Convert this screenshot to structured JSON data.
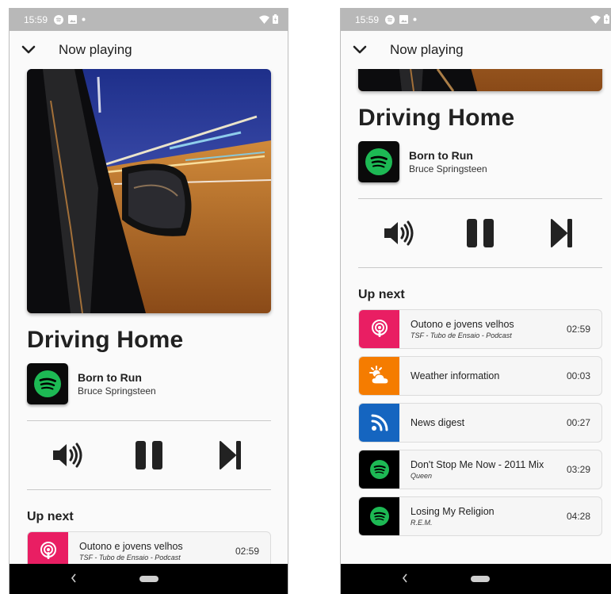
{
  "status": {
    "time": "15:59"
  },
  "app_bar": {
    "title": "Now playing"
  },
  "now_playing": {
    "title": "Driving Home",
    "source_title": "Born to Run",
    "source_subtitle": "Bruce Springsteen"
  },
  "up_next": {
    "heading": "Up next",
    "items": [
      {
        "title": "Outono e jovens velhos",
        "subtitle": "TSF - Tubo de Ensaio - Podcast",
        "duration": "02:59",
        "icon": "podcast-icon",
        "color": "#e91e63"
      },
      {
        "title": "Weather information",
        "subtitle": "",
        "duration": "00:03",
        "icon": "weather-icon",
        "color": "#f57c00"
      },
      {
        "title": "News digest",
        "subtitle": "",
        "duration": "00:27",
        "icon": "rss-icon",
        "color": "#1565c0"
      },
      {
        "title": "Don't Stop Me Now - 2011 Mix",
        "subtitle": "Queen",
        "duration": "03:29",
        "icon": "spotify-icon",
        "color": "#000000"
      },
      {
        "title": "Losing My Religion",
        "subtitle": "R.E.M.",
        "duration": "04:28",
        "icon": "spotify-icon",
        "color": "#000000"
      }
    ]
  },
  "colors": {
    "spotify_green": "#1db954",
    "status_bar": "#b8b8b8",
    "nav_bar": "#000000"
  }
}
